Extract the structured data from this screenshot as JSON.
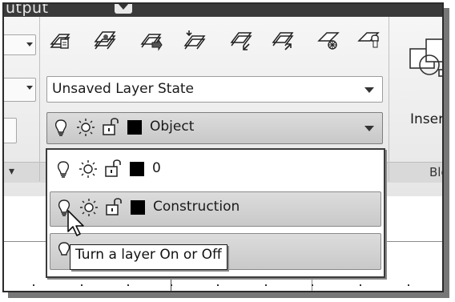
{
  "ribbon": {
    "tab_label": "utput",
    "layers_panel": {
      "layer_state_value": "Unsaved Layer State",
      "current_layer": {
        "name": "Object",
        "color": "#000000"
      },
      "tool_icons": [
        "layer-properties-icon",
        "layer-states-icon",
        "make-current-icon",
        "match-layer-icon",
        "previous-layer-icon",
        "isolate-layer-icon",
        "freeze-layer-icon",
        "lock-layer-icon"
      ]
    },
    "block_panel": {
      "insert_label": "Inser",
      "footer_label": "Blo"
    }
  },
  "layer_dropdown": {
    "items": [
      {
        "name": "0",
        "color": "#000000"
      },
      {
        "name": "Construction",
        "color": "#000000"
      },
      {
        "name": "",
        "color": "#000000"
      }
    ]
  },
  "tooltip": {
    "text": "Turn a layer On or Off"
  },
  "colors": {
    "ribbon_bg": "#ececec",
    "tabstrip": "#3a3a3a",
    "hover_row": "#d2d2d2"
  }
}
